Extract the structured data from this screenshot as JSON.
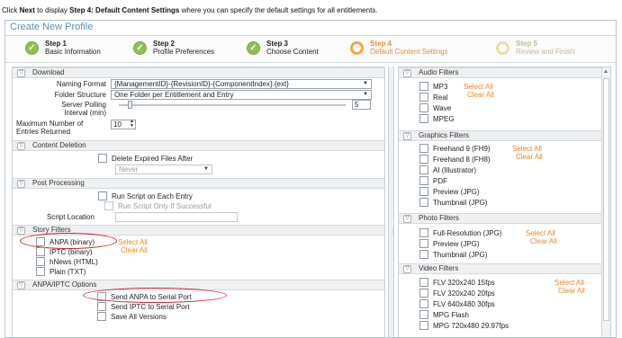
{
  "instruction": {
    "p1": "Click ",
    "next": "Next",
    "p2": " to display ",
    "step": "Step 4: Default Content Settings",
    "p3": " where you can specify the default settings for all entitlements."
  },
  "wizard": {
    "title": "Create New Profile",
    "steps": [
      {
        "line1": "Step 1",
        "line2": "Basic Information",
        "state": "done"
      },
      {
        "line1": "Step 2",
        "line2": "Profile Preferences",
        "state": "done"
      },
      {
        "line1": "Step 3",
        "line2": "Choose Content",
        "state": "done"
      },
      {
        "line1": "Step 4",
        "line2": "Default Content Settings",
        "state": "current"
      },
      {
        "line1": "Step 5",
        "line2": "Review and Finish",
        "state": "pending"
      }
    ]
  },
  "left": {
    "download": {
      "title": "Download",
      "naming_label": "Naming Format",
      "naming_value": "{ManagementID}-{RevisionID}-{ComponentIndex}.{ext}",
      "folder_label": "Folder Structure",
      "folder_value": "One Folder per Entitlement and Entry",
      "polling_label1": "Server Polling",
      "polling_label2": "Interval (min)",
      "polling_value": "5",
      "max_label1": "Maximum Number of",
      "max_label2": "Entries Returned",
      "max_value": "10"
    },
    "deletion": {
      "title": "Content Deletion",
      "delete_label": "Delete Expired Files After",
      "never_value": "Never"
    },
    "post": {
      "title": "Post Processing",
      "run_label": "Run Script on Each Entry",
      "run_success_label": "Run Script Only If Successful",
      "location_label": "Script Location"
    },
    "story": {
      "title": "Story Filters",
      "items": [
        "ANPA (binary)",
        "IPTC (binary)",
        "hNews (HTML)",
        "Plain (TXT)"
      ],
      "select_all": "Select All",
      "clear_all": "Clear All"
    },
    "anpa": {
      "title": "ANPA/IPTC Options",
      "items": [
        "Send ANPA to Serial Port",
        "Send IPTC to Serial Port",
        "Save All Versions"
      ]
    }
  },
  "right": {
    "audio": {
      "title": "Audio Filters",
      "items": [
        "MP3",
        "Real",
        "Wave",
        "MPEG"
      ],
      "select_all": "Select All",
      "clear_all": "Clear All"
    },
    "graphics": {
      "title": "Graphics Filters",
      "items": [
        "Freehand 9 (FH9)",
        "Freehand 8 (FH8)",
        "AI (Illustrator)",
        "PDF",
        "Preview (JPG)",
        "Thumbnail (JPG)"
      ],
      "select_all": "Select All",
      "clear_all": "Clear All"
    },
    "photo": {
      "title": "Photo Filters",
      "items": [
        "Full-Resolution (JPG)",
        "Preview (JPG)",
        "Thumbnail (JPG)"
      ],
      "select_all": "Select All",
      "clear_all": "Clear All"
    },
    "video": {
      "title": "Video Filters",
      "items": [
        "FLV 320x240 15fps",
        "FLV 320x240 20fps",
        "FLV 640x480 30fps",
        "MPG Flash",
        "MPG 720x480 29.97fps"
      ],
      "select_all": "Select All",
      "clear_all": "Clear All"
    }
  },
  "colors": {
    "accent": "#e8861e",
    "title": "#5b8fb2",
    "highlight_oval": "#c9262c",
    "step_done": "#8cc152"
  },
  "icons": [
    "check-icon",
    "collapse-toggle-icon",
    "dropdown-arrow-icon",
    "spinner-icon",
    "scroll-up-icon"
  ]
}
